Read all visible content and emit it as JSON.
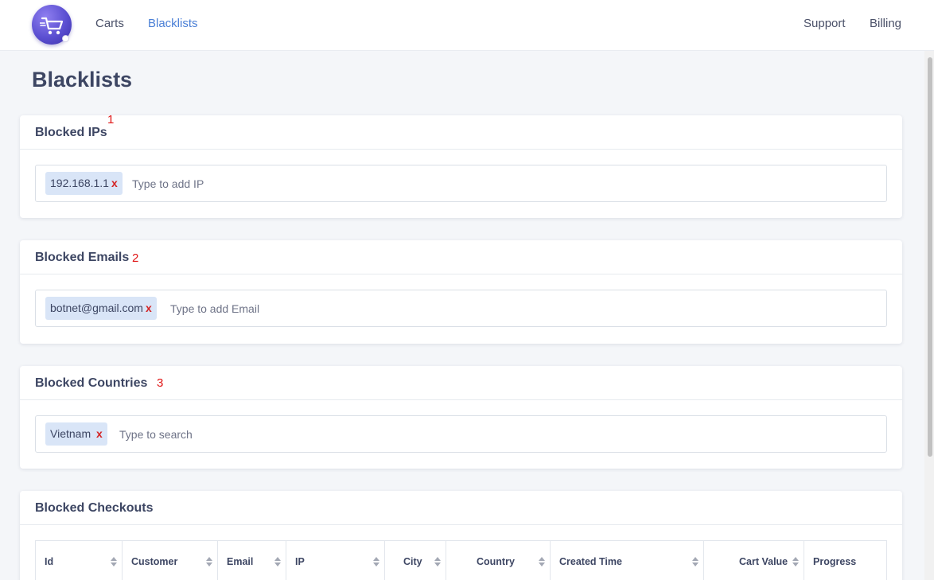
{
  "nav": {
    "left": [
      {
        "label": "Carts",
        "active": false
      },
      {
        "label": "Blacklists",
        "active": true
      }
    ],
    "right": [
      {
        "label": "Support"
      },
      {
        "label": "Billing"
      }
    ]
  },
  "page": {
    "title": "Blacklists"
  },
  "blocked_ips": {
    "title": "Blocked IPs",
    "marker": "1",
    "tags": [
      "192.168.1.1"
    ],
    "remove_label": "x",
    "placeholder": "Type to add IP"
  },
  "blocked_emails": {
    "title": "Blocked Emails",
    "marker": "2",
    "tags": [
      "botnet@gmail.com"
    ],
    "remove_label": "x",
    "placeholder": "Type to add Email"
  },
  "blocked_countries": {
    "title": "Blocked Countries",
    "marker": "3",
    "tags": [
      "Vietnam"
    ],
    "remove_label": "x",
    "placeholder": "Type to search"
  },
  "blocked_checkouts": {
    "title": "Blocked Checkouts",
    "columns": [
      "Id",
      "Customer",
      "Email",
      "IP",
      "City",
      "Country",
      "Created Time",
      "Cart Value",
      "Progress"
    ]
  },
  "colors": {
    "accent": "#4a7fd6",
    "marker": "#e01515",
    "tag_bg": "#d9e5f7",
    "remove": "#d42424"
  },
  "icons": {
    "logo": "shopping-cart-icon",
    "sort": "sort-icon"
  }
}
